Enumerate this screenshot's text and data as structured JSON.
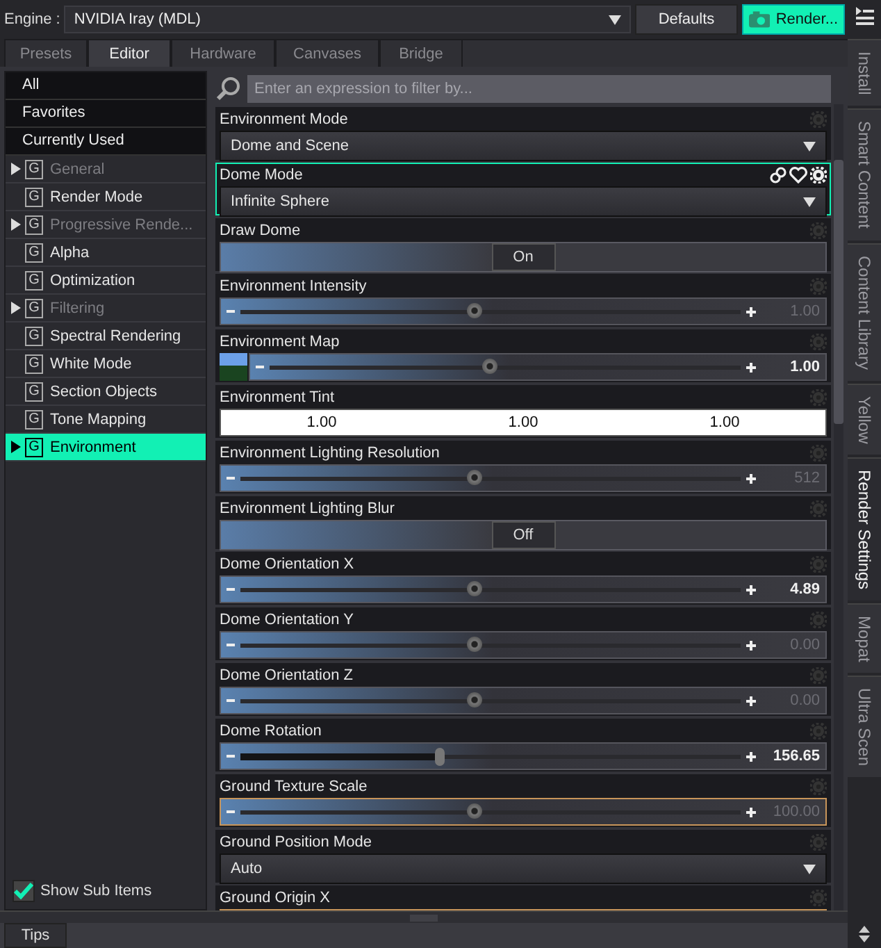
{
  "top_bar": {
    "engine_label": "Engine :",
    "engine_value": "NVIDIA Iray (MDL)",
    "defaults_button": "Defaults",
    "render_button": "Render..."
  },
  "tabs": [
    {
      "label": "Presets",
      "selected": false
    },
    {
      "label": "Editor",
      "selected": true
    },
    {
      "label": "Hardware",
      "selected": false
    },
    {
      "label": "Canvases",
      "selected": false
    },
    {
      "label": "Bridge",
      "selected": false
    }
  ],
  "filters": [
    {
      "label": "All"
    },
    {
      "label": "Favorites"
    },
    {
      "label": "Currently Used"
    }
  ],
  "groups": [
    {
      "glyph": "G",
      "label": "General",
      "expandable": true,
      "dimmed": true,
      "selected": false
    },
    {
      "glyph": "G",
      "label": "Render Mode",
      "expandable": false,
      "dimmed": false,
      "selected": false
    },
    {
      "glyph": "G",
      "label": "Progressive Rende...",
      "expandable": true,
      "dimmed": true,
      "selected": false
    },
    {
      "glyph": "G",
      "label": "Alpha",
      "expandable": false,
      "dimmed": false,
      "selected": false
    },
    {
      "glyph": "G",
      "label": "Optimization",
      "expandable": false,
      "dimmed": false,
      "selected": false
    },
    {
      "glyph": "G",
      "label": "Filtering",
      "expandable": true,
      "dimmed": true,
      "selected": false
    },
    {
      "glyph": "G",
      "label": "Spectral Rendering",
      "expandable": false,
      "dimmed": false,
      "selected": false
    },
    {
      "glyph": "G",
      "label": "White Mode",
      "expandable": false,
      "dimmed": false,
      "selected": false
    },
    {
      "glyph": "G",
      "label": "Section Objects",
      "expandable": false,
      "dimmed": false,
      "selected": false
    },
    {
      "glyph": "G",
      "label": "Tone Mapping",
      "expandable": false,
      "dimmed": false,
      "selected": false
    },
    {
      "glyph": "G",
      "label": "Environment",
      "expandable": true,
      "dimmed": false,
      "selected": true
    }
  ],
  "show_sub_items": {
    "label": "Show Sub Items",
    "checked": true
  },
  "filter_field": {
    "placeholder": "Enter an expression to filter by..."
  },
  "properties": [
    {
      "label": "Environment Mode",
      "kind": "dropdown",
      "value": "Dome and Scene",
      "selected": false
    },
    {
      "label": "Dome Mode",
      "kind": "dropdown",
      "value": "Infinite Sphere",
      "selected": true
    },
    {
      "label": "Draw Dome",
      "kind": "toggle",
      "value": "On",
      "selected": false
    },
    {
      "label": "Environment Intensity",
      "kind": "slider",
      "value": "1.00",
      "level": 0.47,
      "modified": false,
      "selected": false
    },
    {
      "label": "Environment Map",
      "kind": "map_slider",
      "value": "1.00",
      "level": 0.47,
      "modified": true,
      "selected": false
    },
    {
      "label": "Environment Tint",
      "kind": "tint",
      "values": [
        "1.00",
        "1.00",
        "1.00"
      ],
      "selected": false
    },
    {
      "label": "Environment Lighting Resolution",
      "kind": "slider",
      "value": "512",
      "level": 0.47,
      "modified": false,
      "selected": false
    },
    {
      "label": "Environment Lighting Blur",
      "kind": "toggle",
      "value": "Off",
      "selected": false
    },
    {
      "label": "Dome Orientation X",
      "kind": "slider",
      "value": "4.89",
      "level": 0.47,
      "modified": true,
      "selected": false
    },
    {
      "label": "Dome Orientation Y",
      "kind": "slider",
      "value": "0.00",
      "level": 0.47,
      "modified": false,
      "selected": false
    },
    {
      "label": "Dome Orientation Z",
      "kind": "slider",
      "value": "0.00",
      "level": 0.47,
      "modified": false,
      "selected": false
    },
    {
      "label": "Dome Rotation",
      "kind": "slider",
      "value": "156.65",
      "level": 0.4,
      "modified": true,
      "filled": true,
      "selected": false
    },
    {
      "label": "Ground Texture Scale",
      "kind": "slider",
      "value": "100.00",
      "level": 0.47,
      "modified": false,
      "outlined": true,
      "selected": false
    },
    {
      "label": "Ground Position Mode",
      "kind": "dropdown",
      "value": "Auto",
      "selected": false
    },
    {
      "label": "Ground Origin X",
      "kind": "partial",
      "outlined": true,
      "selected": false
    }
  ],
  "side_tabs": [
    {
      "label": "Install",
      "selected": false
    },
    {
      "label": "Smart Content",
      "selected": false
    },
    {
      "label": "Content Library",
      "selected": false
    },
    {
      "label": "Yellow",
      "selected": false
    },
    {
      "label": "Render Settings",
      "selected": true
    },
    {
      "label": "Mopat",
      "selected": false
    },
    {
      "label": "Ultra Scen",
      "selected": false
    }
  ],
  "tips_tab": "Tips"
}
